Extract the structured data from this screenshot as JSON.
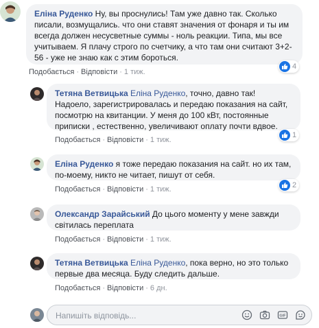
{
  "comments": [
    {
      "author": "Еліна Руденко",
      "text": " Ну, вы проснулись! Там уже давно так. Сколько писали, возмущались. что они ставят значения от фонаря и ты им всегда должен несусветные суммы - ноль реакции. Типа, мы все учитываем. Я плачу строго по счетчику, а что там они считают 3+2-56 - уже не знаю как с этим бороться.",
      "like": "Подобається",
      "reply": "Відповісти",
      "time": "1 тиж.",
      "reactions": "4"
    }
  ],
  "replies": [
    {
      "author": "Тетяна Ветвицька",
      "mention": "Еліна Руденко",
      "text": ", точно, давно так! Надоело, зарегистрировалась и передаю показания на сайт, посмотрю на квитанции. У меня до 100 кВт, постоянные приписки , естественно, увеличивают оплату почти вдвое.",
      "like": "Подобається",
      "reply": "Відповісти",
      "time": "1 тиж.",
      "reactions": "1"
    },
    {
      "author": "Еліна Руденко",
      "mention": "",
      "text": " я тоже передаю показания на сайт. но их там, по-моему, никто не читает, пишут от себя.",
      "like": "Подобається",
      "reply": "Відповісти",
      "time": "1 тиж.",
      "reactions": "2"
    },
    {
      "author": "Олександр Зарайський",
      "mention": "",
      "text": " До цього моменту у мене завжди світилась переплата",
      "like": "Подобається",
      "reply": "Відповісти",
      "time": "1 тиж.",
      "reactions": ""
    },
    {
      "author": "Тетяна Ветвицька",
      "mention": "Еліна Руденко",
      "text": ", пока верно, но это только первые два месяца. Буду следить дальше.",
      "like": "Подобається",
      "reply": "Відповісти",
      "time": "6 дн.",
      "reactions": ""
    }
  ],
  "reply_box": {
    "placeholder": "Напишіть відповідь..."
  },
  "icons": {
    "like": "thumbs-up-icon",
    "emoji": "smiley-icon",
    "camera": "camera-icon",
    "gif": "gif-icon",
    "sticker": "sticker-icon"
  },
  "colors": {
    "author": "#385898",
    "bubble": "#f2f3f5",
    "like_badge": "#1b74e4",
    "meta": "#90949c"
  }
}
